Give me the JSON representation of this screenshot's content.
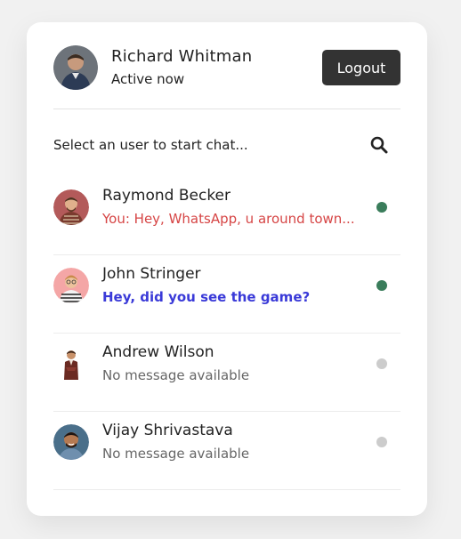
{
  "colors": {
    "online": "#3a7d5b",
    "offline": "#cccccc",
    "sent_message": "#d64545",
    "unread_message": "#3a3ad8",
    "default_message": "#666666"
  },
  "current_user": {
    "name": "Richard Whitman",
    "status": "Active now"
  },
  "header": {
    "logout_label": "Logout"
  },
  "search": {
    "prompt": "Select an user to start chat..."
  },
  "users": [
    {
      "name": "Raymond Becker",
      "message": "You: Hey, WhatsApp, u around town...",
      "status": "online",
      "message_style": "sent"
    },
    {
      "name": "John Stringer",
      "message": "Hey, did you see the game?",
      "status": "online",
      "message_style": "unread"
    },
    {
      "name": "Andrew Wilson",
      "message": "No message available",
      "status": "offline",
      "message_style": "default"
    },
    {
      "name": "Vijay Shrivastava",
      "message": "No message available",
      "status": "offline",
      "message_style": "default"
    }
  ]
}
